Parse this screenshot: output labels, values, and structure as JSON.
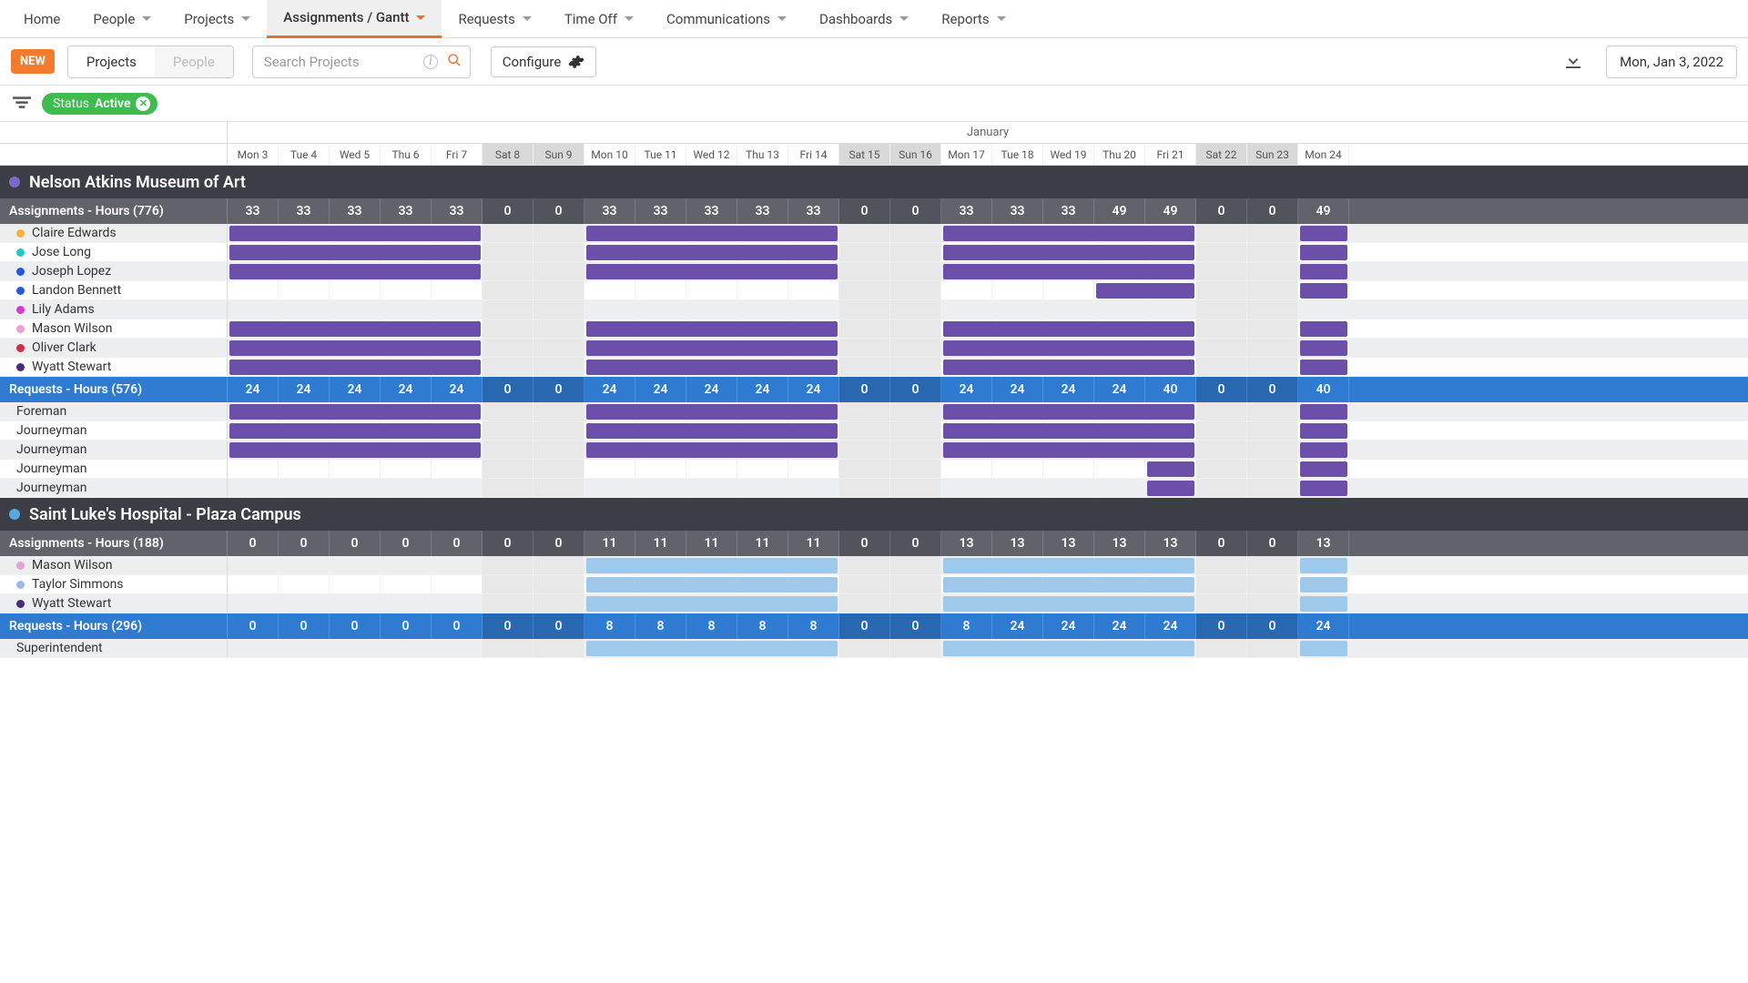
{
  "nav": {
    "items": [
      {
        "label": "Home",
        "dropdown": false
      },
      {
        "label": "People",
        "dropdown": true
      },
      {
        "label": "Projects",
        "dropdown": true
      },
      {
        "label": "Assignments / Gantt",
        "dropdown": true,
        "active": true
      },
      {
        "label": "Requests",
        "dropdown": true
      },
      {
        "label": "Time Off",
        "dropdown": true
      },
      {
        "label": "Communications",
        "dropdown": true
      },
      {
        "label": "Dashboards",
        "dropdown": true
      },
      {
        "label": "Reports",
        "dropdown": true
      }
    ]
  },
  "toolbar": {
    "new_label": "NEW",
    "segments": [
      {
        "label": "Projects",
        "active": true
      },
      {
        "label": "People",
        "active": false
      }
    ],
    "search_placeholder": "Search Projects",
    "configure_label": "Configure",
    "date_display": "Mon, Jan 3, 2022"
  },
  "filter": {
    "status_label": "Status",
    "status_value": "Active"
  },
  "timeline": {
    "month": "January",
    "days": [
      {
        "label": "Mon 3",
        "weekend": false
      },
      {
        "label": "Tue 4",
        "weekend": false
      },
      {
        "label": "Wed 5",
        "weekend": false
      },
      {
        "label": "Thu 6",
        "weekend": false
      },
      {
        "label": "Fri 7",
        "weekend": false
      },
      {
        "label": "Sat 8",
        "weekend": true
      },
      {
        "label": "Sun 9",
        "weekend": true
      },
      {
        "label": "Mon 10",
        "weekend": false
      },
      {
        "label": "Tue 11",
        "weekend": false
      },
      {
        "label": "Wed 12",
        "weekend": false
      },
      {
        "label": "Thu 13",
        "weekend": false
      },
      {
        "label": "Fri 14",
        "weekend": false
      },
      {
        "label": "Sat 15",
        "weekend": true
      },
      {
        "label": "Sun 16",
        "weekend": true
      },
      {
        "label": "Mon 17",
        "weekend": false
      },
      {
        "label": "Tue 18",
        "weekend": false
      },
      {
        "label": "Wed 19",
        "weekend": false
      },
      {
        "label": "Thu 20",
        "weekend": false
      },
      {
        "label": "Fri 21",
        "weekend": false
      },
      {
        "label": "Sat 22",
        "weekend": true
      },
      {
        "label": "Sun 23",
        "weekend": true
      },
      {
        "label": "Mon 24",
        "weekend": false
      }
    ]
  },
  "projects": [
    {
      "name": "Nelson Atkins Museum of Art",
      "color": "#7a6bc9",
      "bar_color": "purple",
      "assignments": {
        "label": "Assignments - Hours (776)",
        "hours": [
          "33",
          "33",
          "33",
          "33",
          "33",
          "0",
          "0",
          "33",
          "33",
          "33",
          "33",
          "33",
          "0",
          "0",
          "33",
          "33",
          "33",
          "49",
          "49",
          "0",
          "0",
          "49"
        ],
        "rows": [
          {
            "name": "Claire Edwards",
            "dot": "#f3b63a",
            "bars": [
              [
                0,
                5
              ],
              [
                7,
                12
              ],
              [
                14,
                19
              ],
              [
                21,
                22
              ]
            ]
          },
          {
            "name": "Jose Long",
            "dot": "#28c6c0",
            "bars": [
              [
                0,
                5
              ],
              [
                7,
                12
              ],
              [
                14,
                19
              ],
              [
                21,
                22
              ]
            ]
          },
          {
            "name": "Joseph Lopez",
            "dot": "#2a55e0",
            "bars": [
              [
                0,
                5
              ],
              [
                7,
                12
              ],
              [
                14,
                19
              ],
              [
                21,
                22
              ]
            ]
          },
          {
            "name": "Landon Bennett",
            "dot": "#2a55e0",
            "bars": [
              [
                17,
                19
              ],
              [
                21,
                22
              ]
            ]
          },
          {
            "name": "Lily Adams",
            "dot": "#d63bd0",
            "bars": []
          },
          {
            "name": "Mason Wilson",
            "dot": "#e7a1d4",
            "bars": [
              [
                0,
                5
              ],
              [
                7,
                12
              ],
              [
                14,
                19
              ],
              [
                21,
                22
              ]
            ]
          },
          {
            "name": "Oliver Clark",
            "dot": "#d12e4a",
            "bars": [
              [
                0,
                5
              ],
              [
                7,
                12
              ],
              [
                14,
                19
              ],
              [
                21,
                22
              ]
            ]
          },
          {
            "name": "Wyatt Stewart",
            "dot": "#4b2a7a",
            "bars": [
              [
                0,
                5
              ],
              [
                7,
                12
              ],
              [
                14,
                19
              ],
              [
                21,
                22
              ]
            ]
          }
        ]
      },
      "requests": {
        "label": "Requests - Hours (576)",
        "hours": [
          "24",
          "24",
          "24",
          "24",
          "24",
          "0",
          "0",
          "24",
          "24",
          "24",
          "24",
          "24",
          "0",
          "0",
          "24",
          "24",
          "24",
          "24",
          "40",
          "0",
          "0",
          "40"
        ],
        "rows": [
          {
            "name": "Foreman",
            "bars": [
              [
                0,
                5
              ],
              [
                7,
                12
              ],
              [
                14,
                19
              ],
              [
                21,
                22
              ]
            ]
          },
          {
            "name": "Journeyman",
            "bars": [
              [
                0,
                5
              ],
              [
                7,
                12
              ],
              [
                14,
                19
              ],
              [
                21,
                22
              ]
            ]
          },
          {
            "name": "Journeyman",
            "bars": [
              [
                0,
                5
              ],
              [
                7,
                12
              ],
              [
                14,
                19
              ],
              [
                21,
                22
              ]
            ]
          },
          {
            "name": "Journeyman",
            "bars": [
              [
                18,
                19
              ],
              [
                21,
                22
              ]
            ]
          },
          {
            "name": "Journeyman",
            "bars": [
              [
                18,
                19
              ],
              [
                21,
                22
              ]
            ]
          }
        ]
      }
    },
    {
      "name": "Saint Luke's Hospital - Plaza Campus",
      "color": "#5aa7e0",
      "bar_color": "blue",
      "assignments": {
        "label": "Assignments - Hours (188)",
        "hours": [
          "0",
          "0",
          "0",
          "0",
          "0",
          "0",
          "0",
          "11",
          "11",
          "11",
          "11",
          "11",
          "0",
          "0",
          "13",
          "13",
          "13",
          "13",
          "13",
          "0",
          "0",
          "13"
        ],
        "rows": [
          {
            "name": "Mason Wilson",
            "dot": "#e7a1d4",
            "bars": [
              [
                7,
                12
              ],
              [
                14,
                19
              ],
              [
                21,
                22
              ]
            ]
          },
          {
            "name": "Taylor Simmons",
            "dot": "#9eb7e8",
            "bars": [
              [
                7,
                12
              ],
              [
                14,
                19
              ],
              [
                21,
                22
              ]
            ]
          },
          {
            "name": "Wyatt Stewart",
            "dot": "#4b2a7a",
            "bars": [
              [
                7,
                12
              ],
              [
                14,
                19
              ],
              [
                21,
                22
              ]
            ]
          }
        ]
      },
      "requests": {
        "label": "Requests - Hours (296)",
        "hours": [
          "0",
          "0",
          "0",
          "0",
          "0",
          "0",
          "0",
          "8",
          "8",
          "8",
          "8",
          "8",
          "0",
          "0",
          "8",
          "24",
          "24",
          "24",
          "24",
          "0",
          "0",
          "24"
        ],
        "rows": [
          {
            "name": "Superintendent",
            "bars": [
              [
                7,
                12
              ],
              [
                14,
                19
              ],
              [
                21,
                22
              ]
            ]
          }
        ]
      }
    }
  ]
}
